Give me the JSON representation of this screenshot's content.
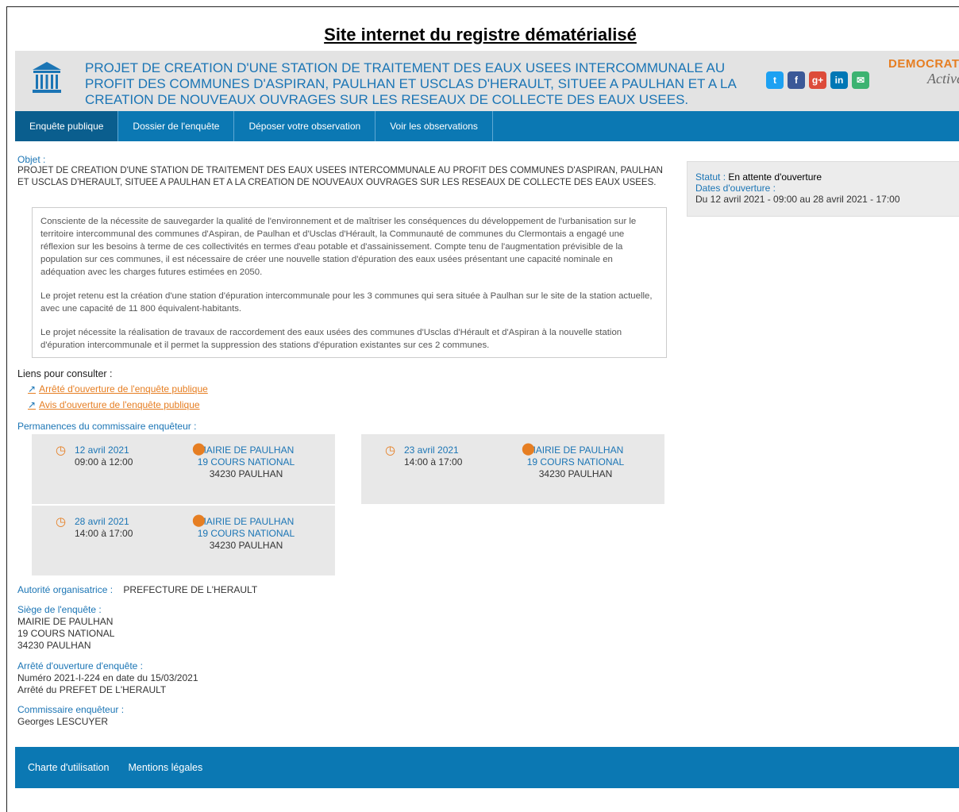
{
  "doc_title": "Site internet du registre dématérialisé",
  "header": {
    "title": "PROJET DE CREATION D'UNE STATION DE TRAITEMENT DES EAUX USEES INTERCOMMUNALE AU PROFIT DES COMMUNES D'ASPIRAN, PAULHAN ET USCLAS D'HERAULT, SITUEE A PAULHAN ET A LA CREATION DE NOUVEAUX OUVRAGES SUR LES RESEAUX DE COLLECTE DES EAUX USEES.",
    "brand_line1": "DEMOCRATIE",
    "brand_line2": "Active",
    "socials": [
      {
        "name": "twitter-icon",
        "glyph": "t",
        "color": "#1da1f2"
      },
      {
        "name": "facebook-icon",
        "glyph": "f",
        "color": "#3b5998"
      },
      {
        "name": "google-plus-icon",
        "glyph": "g+",
        "color": "#dd4b39"
      },
      {
        "name": "linkedin-icon",
        "glyph": "in",
        "color": "#0077b5"
      },
      {
        "name": "email-icon",
        "glyph": "✉",
        "color": "#3cb371"
      }
    ]
  },
  "nav": {
    "tabs": [
      "Enquête publique",
      "Dossier de l'enquête",
      "Déposer votre observation",
      "Voir les observations"
    ]
  },
  "object": {
    "label": "Objet :",
    "text": "PROJET DE CREATION D'UNE STATION DE TRAITEMENT DES EAUX USEES INTERCOMMUNALE AU PROFIT DES COMMUNES D'ASPIRAN, PAULHAN ET USCLAS D'HERAULT, SITUEE A PAULHAN ET A LA CREATION DE NOUVEAUX OUVRAGES SUR LES RESEAUX DE COLLECTE DES EAUX USEES."
  },
  "status": {
    "label": "Statut :",
    "value": "En attente d'ouverture",
    "dates_label": "Dates d'ouverture :",
    "dates_value": "Du 12 avril 2021 - 09:00 au 28 avril 2021 - 17:00"
  },
  "description": {
    "p1": "Consciente de la nécessite de sauvegarder la qualité de l'environnement et de maîtriser les conséquences du développement de l'urbanisation sur le territoire intercommunal des communes d'Aspiran, de Paulhan et d'Usclas d'Hérault, la Communauté de communes du Clermontais a engagé une réflexion sur les besoins à terme de ces collectivités en termes d'eau potable et d'assainissement. Compte tenu de l'augmentation prévisible de la population sur ces communes, il est nécessaire de créer une nouvelle station d'épuration des eaux usées présentant une capacité nominale en adéquation avec les charges futures estimées en 2050.",
    "p2": "Le projet retenu est la création d'une station d'épuration intercommunale pour les 3 communes qui sera située à Paulhan sur le site de la station actuelle, avec une capacité de 11 800 équivalent-habitants.",
    "p3": "Le projet nécessite la réalisation de travaux de raccordement des eaux usées des communes d'Usclas d'Hérault et d'Aspiran à la nouvelle station d'épuration intercommunale et il permet la suppression des stations d'épuration existantes sur ces 2 communes."
  },
  "links": {
    "title": "Liens pour consulter :",
    "items": [
      "Arrêté d'ouverture de l'enquête publique",
      "Avis d'ouverture de l'enquête publique"
    ]
  },
  "permanences": {
    "title": "Permanences du commissaire enquêteur :",
    "items": [
      {
        "date": "12 avril 2021",
        "hours": "09:00 à 12:00",
        "place": "MAIRIE DE PAULHAN",
        "street": "19 COURS NATIONAL",
        "city": "34230 PAULHAN"
      },
      {
        "date": "23 avril 2021",
        "hours": "14:00 à 17:00",
        "place": "MAIRIE DE PAULHAN",
        "street": "19 COURS NATIONAL",
        "city": "34230 PAULHAN"
      },
      {
        "date": "28 avril 2021",
        "hours": "14:00 à 17:00",
        "place": "MAIRIE DE PAULHAN",
        "street": "19 COURS NATIONAL",
        "city": "34230 PAULHAN"
      }
    ]
  },
  "authority": {
    "label": "Autorité organisatrice :",
    "value": "PREFECTURE DE L'HERAULT"
  },
  "seat": {
    "label": "Siège de l'enquête :",
    "line1": "MAIRIE DE PAULHAN",
    "line2": "19 COURS NATIONAL",
    "line3": "34230 PAULHAN"
  },
  "decree": {
    "label": "Arrêté d'ouverture d'enquête :",
    "line1": "Numéro 2021-I-224 en date du 15/03/2021",
    "line2": "Arrêté du PREFET DE L'HERAULT"
  },
  "commissioner": {
    "label": "Commissaire enquêteur :",
    "value": "Georges LESCUYER"
  },
  "footer": {
    "links": [
      "Charte d'utilisation",
      "Mentions légales"
    ]
  }
}
